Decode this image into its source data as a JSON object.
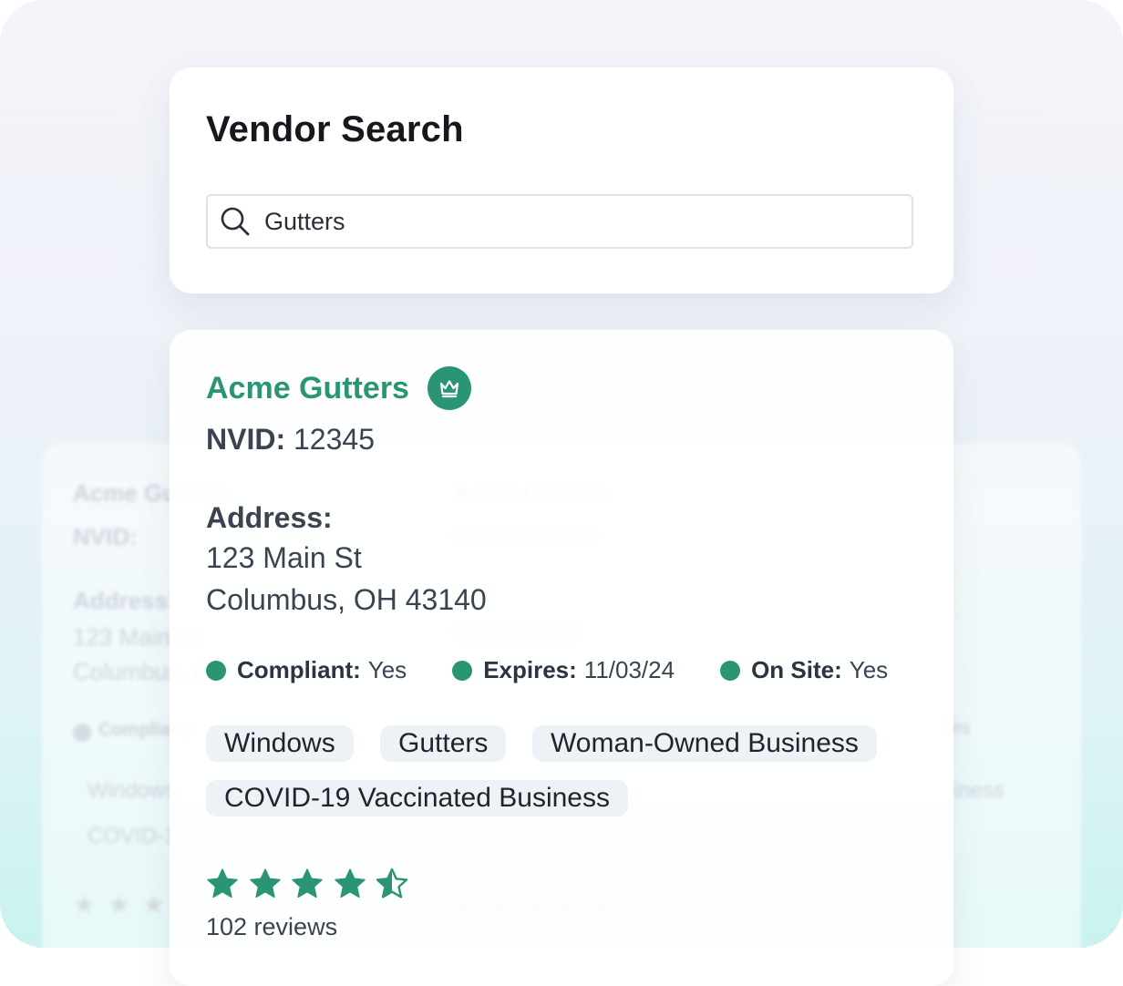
{
  "search": {
    "title": "Vendor Search",
    "value": "Gutters",
    "icon": "search-icon"
  },
  "vendor": {
    "name": "Acme Gutters",
    "badge_icon": "crown-icon",
    "nvid_label": "NVID:",
    "nvid_value": "12345",
    "address_label": "Address:",
    "address_line1": "123 Main St",
    "address_line2": "Columbus, OH 43140",
    "status": [
      {
        "label": "Compliant:",
        "value": "Yes"
      },
      {
        "label": "Expires:",
        "value": "11/03/24"
      },
      {
        "label": "On Site:",
        "value": "Yes"
      }
    ],
    "tags": [
      "Windows",
      "Gutters",
      "Woman-Owned Business",
      "COVID-19 Vaccinated Business"
    ],
    "rating": 4.5,
    "rating_max": 5,
    "reviews": "102 reviews"
  },
  "colors": {
    "accent": "#2a9575",
    "title": "#16181d",
    "text": "#3c4250",
    "tag_bg": "#eef1f6"
  }
}
